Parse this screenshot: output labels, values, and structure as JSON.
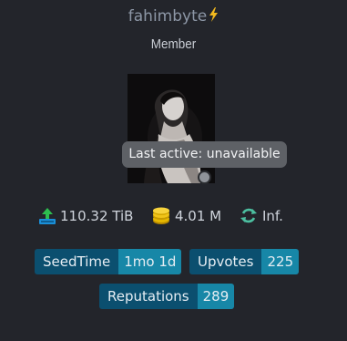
{
  "profile": {
    "username": "fahimbyte",
    "rank": "Member",
    "tooltip": "Last active: unavailable"
  },
  "stats": {
    "upload": "110.32 TiB",
    "bonus": "4.01 M",
    "ratio": "Inf."
  },
  "badges": {
    "seedtime": {
      "label": "SeedTime",
      "value": "1mo 1d"
    },
    "upvotes": {
      "label": "Upvotes",
      "value": "225"
    },
    "reputations": {
      "label": "Reputations",
      "value": "289"
    }
  },
  "colors": {
    "background": "#23252b",
    "badge_label": "#0b4f6f",
    "badge_value": "#1787a7",
    "upload_icon": "#1a8fd8",
    "coin_icon": "#e6b800",
    "ratio_icon": "#4cbfa0"
  },
  "icons": {
    "username": "lightning-icon",
    "upload": "upload-icon",
    "bonus": "coins-icon",
    "ratio": "sync-icon"
  }
}
